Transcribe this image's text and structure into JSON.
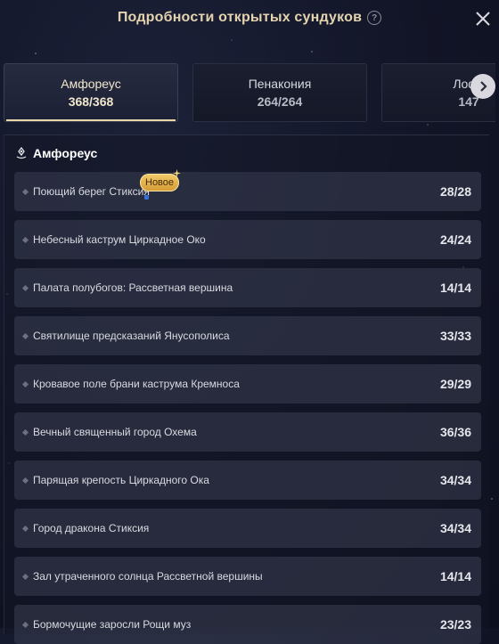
{
  "header": {
    "title": "Подробности открытых сундуков",
    "help_glyph": "?"
  },
  "tabs": [
    {
      "name": "Амфореус",
      "count": "368/368",
      "active": true
    },
    {
      "name": "Пенакония",
      "count": "264/264",
      "active": false
    },
    {
      "name": "Лофу",
      "count": "147",
      "active": false
    }
  ],
  "section": {
    "title": "Амфореус",
    "icon": "location-icon"
  },
  "badge_new": "Новое",
  "rows": [
    {
      "name": "Поющий берег Стиксия",
      "count": "28/28"
    },
    {
      "name": "Небесный каструм Циркадное Око",
      "count": "24/24"
    },
    {
      "name": "Палата полубогов: Рассветная вершина",
      "count": "14/14"
    },
    {
      "name": "Святилище предсказаний Янусополиса",
      "count": "33/33"
    },
    {
      "name": "Кровавое поле брани каструма Кремноса",
      "count": "29/29"
    },
    {
      "name": "Вечный священный город Охема",
      "count": "36/36"
    },
    {
      "name": "Парящая крепость Циркадного Ока",
      "count": "34/34"
    },
    {
      "name": "Город дракона Стиксия",
      "count": "34/34"
    },
    {
      "name": "Зал утраченного солнца Рассветной вершины",
      "count": "14/14"
    },
    {
      "name": "Бормочущие заросли Рощи муз",
      "count": "23/23"
    }
  ],
  "colors": {
    "title_gold": "#e3d3ae",
    "tab_underline": "#e9d7a8",
    "badge": "#e8b650"
  }
}
